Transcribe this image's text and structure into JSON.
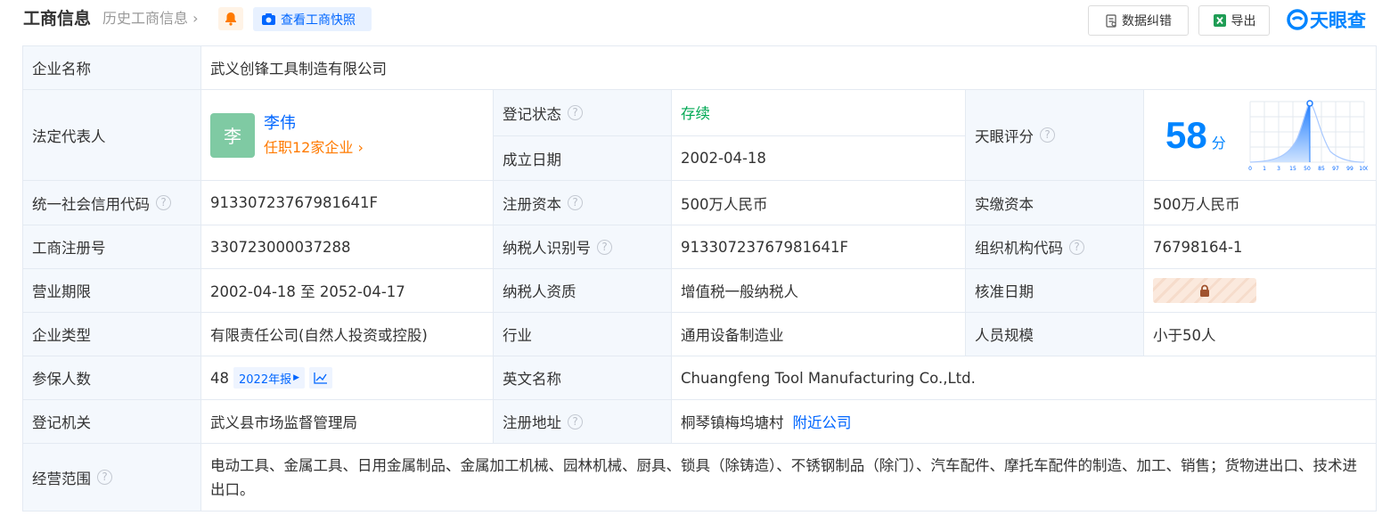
{
  "header": {
    "title": "工商信息",
    "history_link": "历史工商信息",
    "snapshot_button": "查看工商快照",
    "correct_button": "数据纠错",
    "export_button": "导出",
    "logo_text": "天眼查"
  },
  "labels": {
    "company_name": "企业名称",
    "legal_rep": "法定代表人",
    "reg_status": "登记状态",
    "established": "成立日期",
    "tianyan_score": "天眼评分",
    "credit_code": "统一社会信用代码",
    "reg_capital": "注册资本",
    "paid_capital": "实缴资本",
    "biz_reg_no": "工商注册号",
    "taxpayer_id": "纳税人识别号",
    "org_code": "组织机构代码",
    "term": "营业期限",
    "taxpayer_qual": "纳税人资质",
    "approval_date": "核准日期",
    "company_type": "企业类型",
    "industry": "行业",
    "staff_size": "人员规模",
    "insured": "参保人数",
    "english_name": "英文名称",
    "registry": "登记机关",
    "reg_address": "注册地址",
    "scope": "经营范围"
  },
  "values": {
    "company_name": "武义创锋工具制造有限公司",
    "legal_rep_avatar": "李",
    "legal_rep_name": "李伟",
    "legal_rep_roles": "任职12家企业",
    "reg_status": "存续",
    "established": "2002-04-18",
    "score": "58",
    "score_unit": "分",
    "credit_code": "91330723767981641F",
    "reg_capital": "500万人民币",
    "paid_capital": "500万人民币",
    "biz_reg_no": "330723000037288",
    "taxpayer_id": "91330723767981641F",
    "org_code": "76798164-1",
    "term": "2002-04-18 至 2052-04-17",
    "taxpayer_qual": "增值税一般纳税人",
    "company_type": "有限责任公司(自然人投资或控股)",
    "industry": "通用设备制造业",
    "staff_size": "小于50人",
    "insured": "48",
    "insured_year_tag": "2022年报",
    "english_name": "Chuangfeng Tool Manufacturing Co.,Ltd.",
    "registry": "武义县市场监督管理局",
    "reg_address": "桐琴镇梅坞塘村",
    "nearby_link": "附近公司",
    "scope": "电动工具、金属工具、日用金属制品、金属加工机械、园林机械、厨具、锁具（除铸造）、不锈钢制品（除门）、汽车配件、摩托车配件的制造、加工、销售；货物进出口、技术进出口。"
  },
  "score_chart": {
    "ticks": [
      "0",
      "1",
      "3",
      "15",
      "50",
      "85",
      "97",
      "99",
      "100"
    ],
    "marker": "50"
  },
  "colors": {
    "brand": "#0084ff",
    "link": "#0066ff",
    "status_green": "#00a854",
    "orange": "#ff7a00",
    "label_bg": "#f4f8fd",
    "border": "#e4eaf2"
  }
}
